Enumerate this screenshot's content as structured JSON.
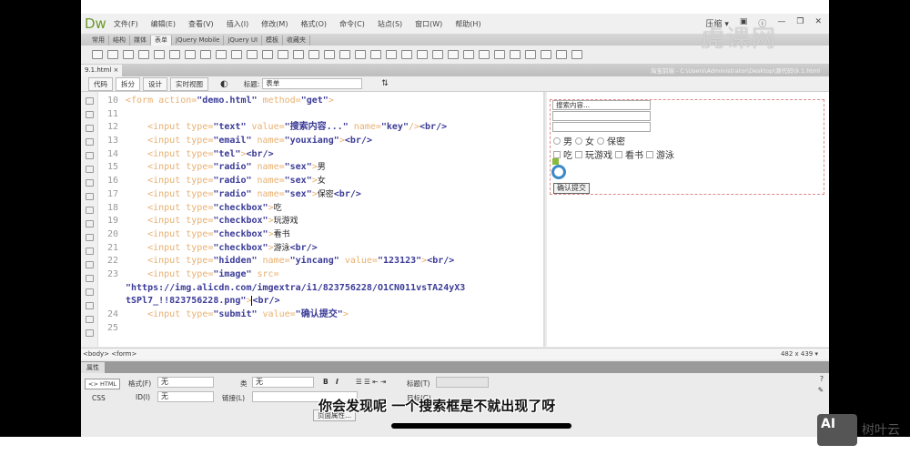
{
  "app": {
    "logo": "Dw",
    "workspace": "压缩 ▾",
    "menu": [
      "文件(F)",
      "编辑(E)",
      "查看(V)",
      "插入(I)",
      "修改(M)",
      "格式(O)",
      "命令(C)",
      "站点(S)",
      "窗口(W)",
      "帮助(H)"
    ]
  },
  "insert_tabs": [
    "常用",
    "结构",
    "媒体",
    "表单",
    "jQuery Mobile",
    "jQuery UI",
    "模板",
    "收藏夹"
  ],
  "active_insert_tab": "表单",
  "document": {
    "tab": "9.1.html",
    "close": "×",
    "path": "淘宝前端 - C:\\Users\\Administrator\\Desktop\\源代码\\9.1.html"
  },
  "doc_toolbar": {
    "views": [
      "代码",
      "拆分",
      "设计",
      "实时视图"
    ],
    "active_view": "拆分",
    "title_label": "标题:",
    "title_value": "表单"
  },
  "code_lines": [
    {
      "n": "10",
      "t": [
        [
          "tag",
          "<form action="
        ],
        [
          "val",
          "\"demo.html\""
        ],
        [
          "tag",
          " method="
        ],
        [
          "val",
          "\"get\""
        ],
        [
          "tag",
          ">"
        ]
      ]
    },
    {
      "n": "11",
      "t": []
    },
    {
      "n": "12",
      "t": [
        [
          "txt",
          "    "
        ],
        [
          "tag",
          "<input type="
        ],
        [
          "val",
          "\"text\""
        ],
        [
          "tag",
          " value="
        ],
        [
          "val",
          "\"搜索内容...\""
        ],
        [
          "tag",
          " name="
        ],
        [
          "val",
          "\"key\""
        ],
        [
          "tag",
          "/>"
        ],
        [
          "val",
          "<br/>"
        ]
      ]
    },
    {
      "n": "13",
      "t": [
        [
          "txt",
          "    "
        ],
        [
          "tag",
          "<input type="
        ],
        [
          "val",
          "\"email\""
        ],
        [
          "tag",
          " name="
        ],
        [
          "val",
          "\"youxiang\""
        ],
        [
          "tag",
          ">"
        ],
        [
          "val",
          "<br/>"
        ]
      ]
    },
    {
      "n": "14",
      "t": [
        [
          "txt",
          "    "
        ],
        [
          "tag",
          "<input type="
        ],
        [
          "val",
          "\"tel\""
        ],
        [
          "tag",
          ">"
        ],
        [
          "val",
          "<br/>"
        ]
      ]
    },
    {
      "n": "15",
      "t": [
        [
          "txt",
          "    "
        ],
        [
          "tag",
          "<input type="
        ],
        [
          "val",
          "\"radio\""
        ],
        [
          "tag",
          " name="
        ],
        [
          "val",
          "\"sex\""
        ],
        [
          "tag",
          ">"
        ],
        [
          "cjk",
          "男"
        ]
      ]
    },
    {
      "n": "16",
      "t": [
        [
          "txt",
          "    "
        ],
        [
          "tag",
          "<input type="
        ],
        [
          "val",
          "\"radio\""
        ],
        [
          "tag",
          " name="
        ],
        [
          "val",
          "\"sex\""
        ],
        [
          "tag",
          ">"
        ],
        [
          "cjk",
          "女"
        ]
      ]
    },
    {
      "n": "17",
      "t": [
        [
          "txt",
          "    "
        ],
        [
          "tag",
          "<input type="
        ],
        [
          "val",
          "\"radio\""
        ],
        [
          "tag",
          " name="
        ],
        [
          "val",
          "\"sex\""
        ],
        [
          "tag",
          ">"
        ],
        [
          "cjk",
          "保密"
        ],
        [
          "val",
          "<br/>"
        ]
      ]
    },
    {
      "n": "18",
      "t": [
        [
          "txt",
          "    "
        ],
        [
          "tag",
          "<input type="
        ],
        [
          "val",
          "\"checkbox\""
        ],
        [
          "tag",
          ">"
        ],
        [
          "cjk",
          "吃"
        ]
      ]
    },
    {
      "n": "19",
      "t": [
        [
          "txt",
          "    "
        ],
        [
          "tag",
          "<input type="
        ],
        [
          "val",
          "\"checkbox\""
        ],
        [
          "tag",
          ">"
        ],
        [
          "cjk",
          "玩游戏"
        ]
      ]
    },
    {
      "n": "20",
      "t": [
        [
          "txt",
          "    "
        ],
        [
          "tag",
          "<input type="
        ],
        [
          "val",
          "\"checkbox\""
        ],
        [
          "tag",
          ">"
        ],
        [
          "cjk",
          "看书"
        ]
      ]
    },
    {
      "n": "21",
      "t": [
        [
          "txt",
          "    "
        ],
        [
          "tag",
          "<input type="
        ],
        [
          "val",
          "\"checkbox\""
        ],
        [
          "tag",
          ">"
        ],
        [
          "cjk",
          "游泳"
        ],
        [
          "val",
          "<br/>"
        ]
      ]
    },
    {
      "n": "22",
      "t": [
        [
          "txt",
          "    "
        ],
        [
          "tag",
          "<input type="
        ],
        [
          "val",
          "\"hidden\""
        ],
        [
          "tag",
          " name="
        ],
        [
          "val",
          "\"yincang\""
        ],
        [
          "tag",
          " value="
        ],
        [
          "val",
          "\"123123\""
        ],
        [
          "tag",
          ">"
        ],
        [
          "val",
          "<br/>"
        ]
      ]
    },
    {
      "n": "23",
      "t": [
        [
          "txt",
          "    "
        ],
        [
          "tag",
          "<input type="
        ],
        [
          "val",
          "\"image\""
        ],
        [
          "tag",
          " src="
        ]
      ]
    },
    {
      "n": "",
      "t": [
        [
          "val",
          "\"https://img.alicdn.com/imgextra/i1/823756228/O1CN011vsTA24yX3"
        ]
      ]
    },
    {
      "n": "",
      "t": [
        [
          "val",
          "tSPl7_!!823756228.png\""
        ],
        [
          "tag",
          ">"
        ],
        [
          "caret",
          ""
        ],
        [
          "val",
          "<br/>"
        ]
      ]
    },
    {
      "n": "24",
      "t": [
        [
          "txt",
          "    "
        ],
        [
          "tag",
          "<input type="
        ],
        [
          "val",
          "\"submit\""
        ],
        [
          "tag",
          " value="
        ],
        [
          "val",
          "\"确认提交\""
        ],
        [
          "tag",
          ">"
        ]
      ]
    },
    {
      "n": "25",
      "t": []
    }
  ],
  "design_view": {
    "text_value": "搜索内容...",
    "radios": [
      "男",
      "女",
      "保密"
    ],
    "checkboxes": [
      "吃",
      "玩游戏",
      "看书",
      "游泳"
    ],
    "submit": "确认提交"
  },
  "status": {
    "tag_selector": "<body> <form>",
    "window_size": "482 x 439 ▾"
  },
  "properties": {
    "tab": "属性",
    "html_btn": "<> HTML",
    "css_btn": "CSS",
    "format_label": "格式(F)",
    "format_value": "无",
    "class_label": "类",
    "class_value": "无",
    "id_label": "ID(I)",
    "id_value": "无",
    "link_label": "链接(L)",
    "title_label": "标题(T)",
    "target_label": "目标(G)",
    "bold": "B",
    "italic": "I",
    "page_props": "页面属性..."
  },
  "video": {
    "subtitle": "你会发现呢  一个搜索框是不就出现了呀",
    "progress": 0.45,
    "watermark": "虎课网",
    "logo_text": "树叶云",
    "logo_mark": "AI"
  },
  "colors": {
    "tag": "#e8b070",
    "value": "#3b3b98",
    "dw_logo": "#6a9a2a"
  }
}
